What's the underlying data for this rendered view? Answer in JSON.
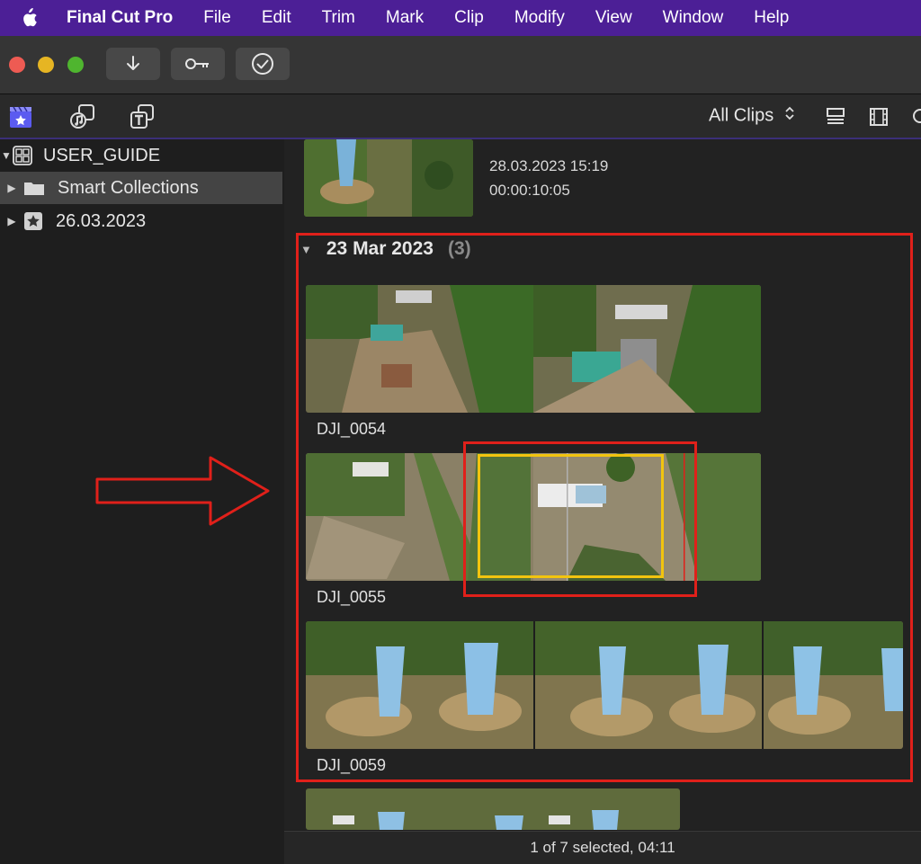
{
  "menubar": {
    "app_name": "Final Cut Pro",
    "items": [
      "File",
      "Edit",
      "Trim",
      "Mark",
      "Clip",
      "Modify",
      "View",
      "Window",
      "Help"
    ]
  },
  "toolbar": {
    "buttons": [
      {
        "icon": "download-arrow-icon"
      },
      {
        "icon": "key-icon"
      },
      {
        "icon": "checkmark-circle-icon"
      }
    ]
  },
  "subbar": {
    "icons": [
      "libraries-icon",
      "photos-audio-icon",
      "titles-generators-icon"
    ],
    "filter_label": "All Clips",
    "filter_icon": "chevron-updown-icon"
  },
  "sidebar": {
    "library": "USER_GUIDE",
    "items": [
      {
        "label": "Smart Collections",
        "icon": "folder-icon"
      },
      {
        "label": "26.03.2023",
        "icon": "star-event-icon"
      }
    ]
  },
  "browser": {
    "top_clip": {
      "date": "28.03.2023 15:19",
      "duration": "00:00:10:05"
    },
    "group": {
      "title": "23 Mar 2023",
      "count": "(3)"
    },
    "clips": [
      {
        "name": "DJI_0054"
      },
      {
        "name": "DJI_0055"
      },
      {
        "name": "DJI_0059"
      }
    ]
  },
  "status": {
    "text": "1 of 7 selected, 04:11"
  },
  "colors": {
    "menubar": "#4c1f96",
    "annotation_red": "#e0201a",
    "selection_yellow": "#f2c40f",
    "accent_purple": "#6a5acd"
  }
}
